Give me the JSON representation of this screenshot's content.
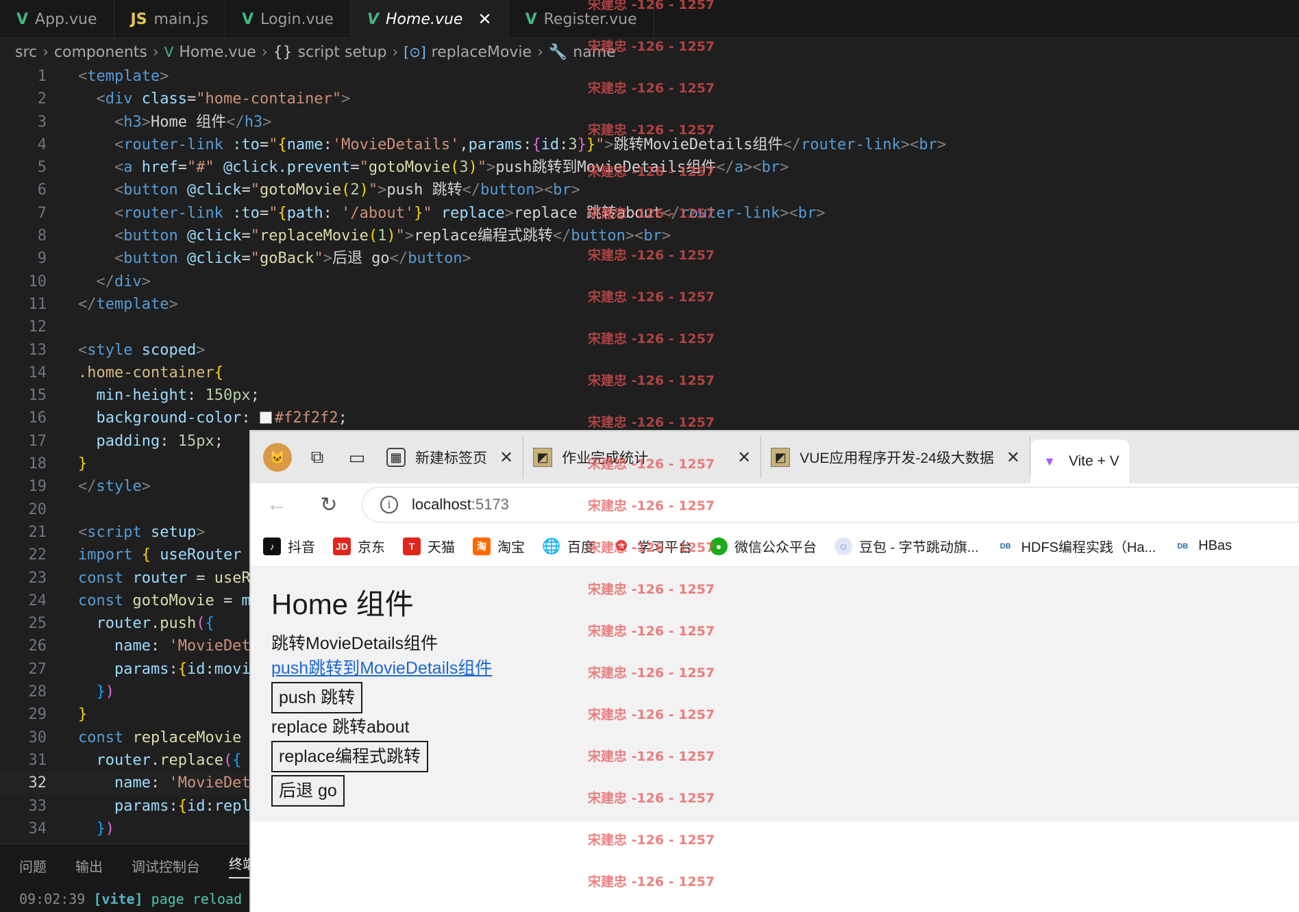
{
  "editor": {
    "tabs": [
      {
        "label": "App.vue",
        "icon": "vue-icon",
        "active": false
      },
      {
        "label": "main.js",
        "icon": "js-icon",
        "active": false
      },
      {
        "label": "Login.vue",
        "icon": "vue-icon",
        "active": false
      },
      {
        "label": "Home.vue",
        "icon": "vue-icon",
        "active": true
      },
      {
        "label": "Register.vue",
        "icon": "vue-icon",
        "active": false
      }
    ],
    "breadcrumb": [
      "src",
      "components",
      "Home.vue",
      "script setup",
      "replaceMovie",
      "name"
    ],
    "current_line": 32,
    "color_swatch": "#f2f2f2"
  },
  "panel": {
    "tabs": [
      "问题",
      "输出",
      "调试控制台",
      "终端"
    ],
    "terminal_line": {
      "time": "09:02:39",
      "tag": "[vite]",
      "msg": "page reload"
    }
  },
  "browser": {
    "tabs": [
      {
        "label": "新建标签页",
        "icon": "new-tab-icon"
      },
      {
        "label": "作业完成统计",
        "icon": "page-favicon"
      },
      {
        "label": "VUE应用程序开发-24级大数据",
        "icon": "page-favicon"
      },
      {
        "label": "Vite + V",
        "icon": "vite-icon",
        "active": true
      }
    ],
    "address": {
      "host": "localhost",
      "port": ":5173"
    },
    "bookmarks": [
      {
        "label": "抖音",
        "icon": "douyin-icon",
        "color": "#111111"
      },
      {
        "label": "京东",
        "icon": "jd-icon",
        "color": "#e1251b"
      },
      {
        "label": "天猫",
        "icon": "tmall-icon",
        "color": "#e1251b"
      },
      {
        "label": "淘宝",
        "icon": "taobao-icon",
        "color": "#ff6a00"
      },
      {
        "label": "百度",
        "icon": "globe-icon",
        "color": "#333333"
      },
      {
        "label": "学习平台",
        "icon": "star-icon",
        "color": "#d33"
      },
      {
        "label": "微信公众平台",
        "icon": "wechat-icon",
        "color": "#1aad19"
      },
      {
        "label": "豆包 - 字节跳动旗...",
        "icon": "doubao-icon",
        "color": "#6b8bd6"
      },
      {
        "label": "HDFS编程实践（Ha...",
        "icon": "lab-icon",
        "color": "#2b6cb0"
      },
      {
        "label": "HBas",
        "icon": "lab-icon",
        "color": "#2b6cb0"
      }
    ]
  },
  "page": {
    "heading": "Home 组件",
    "router_link_1": "跳转MovieDetails组件",
    "anchor_link": "push跳转到MovieDetails组件",
    "push_button": "push 跳转",
    "router_link_2": "replace 跳转about",
    "replace_button": "replace编程式跳转",
    "back_button": "后退 go"
  },
  "watermark": {
    "text": "宋建忠 -126 - 1257",
    "count": 22
  }
}
